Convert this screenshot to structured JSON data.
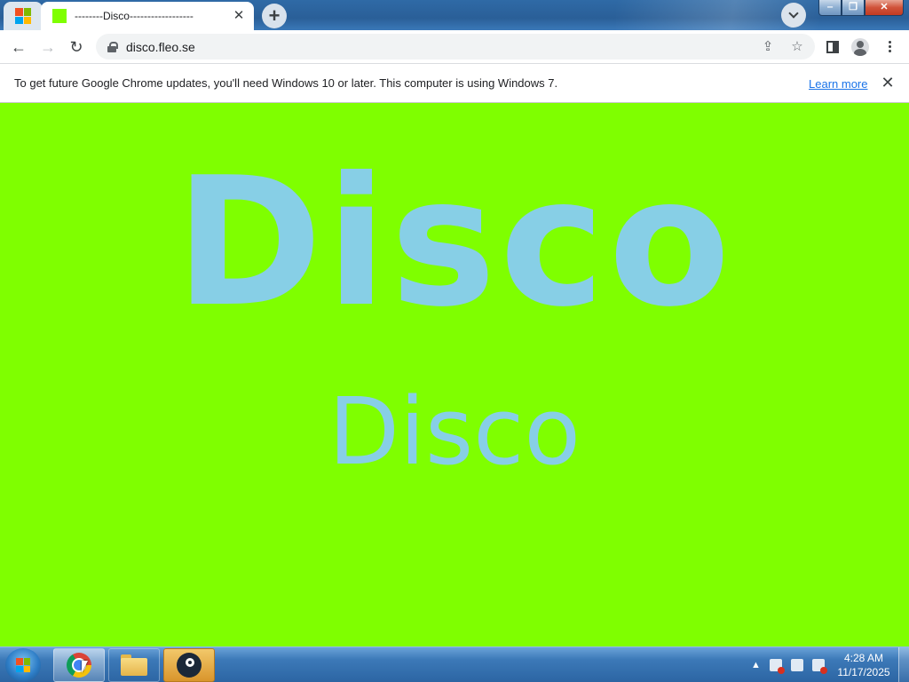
{
  "browser": {
    "tab": {
      "title": "--------Disco------------------",
      "favicon_color": "#7fff00"
    },
    "address": {
      "url": "disco.fleo.se"
    },
    "infobar": {
      "message": "To get future Google Chrome updates, you'll need Windows 10 or later. This computer is using Windows 7.",
      "link": "Learn more"
    }
  },
  "page": {
    "background": "#7fff00",
    "text_color": "#87cfe6",
    "heading": "Disco",
    "subheading": "Disco"
  },
  "taskbar": {
    "items": [
      "Google Chrome",
      "Windows Explorer",
      "Steam"
    ],
    "clock": {
      "time": "4:28 AM",
      "date": "11/17/2025"
    }
  }
}
